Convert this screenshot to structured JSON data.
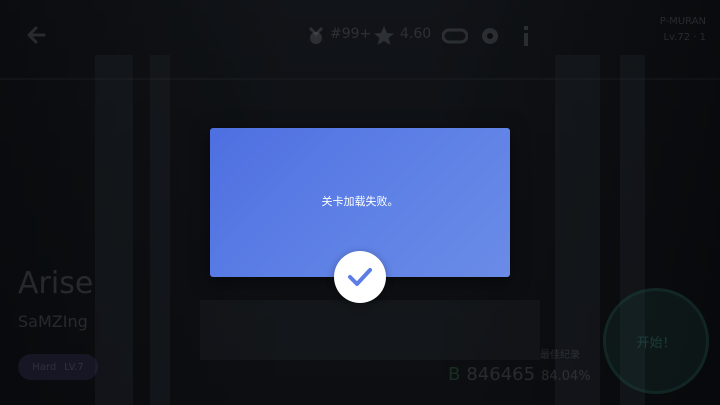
{
  "topbar": {
    "rank_value": "#99+",
    "rating_value": "4.60",
    "account_line1": "P-MURAN",
    "account_line2": "Lv.72 · 1"
  },
  "song": {
    "title": "Arise",
    "artist": "SaMZIng",
    "difficulty_label": "Hard",
    "difficulty_level": "LV.7"
  },
  "record": {
    "label": "最佳纪录",
    "grade": "B",
    "score": "846465",
    "accuracy": "84.04%"
  },
  "start_button": {
    "label": "开始！"
  },
  "dialog": {
    "message": "关卡加载失败。"
  },
  "colors": {
    "dialog_bg": "#5b7de5",
    "confirm_bg": "#ffffff",
    "confirm_icon": "#5b7de5"
  }
}
